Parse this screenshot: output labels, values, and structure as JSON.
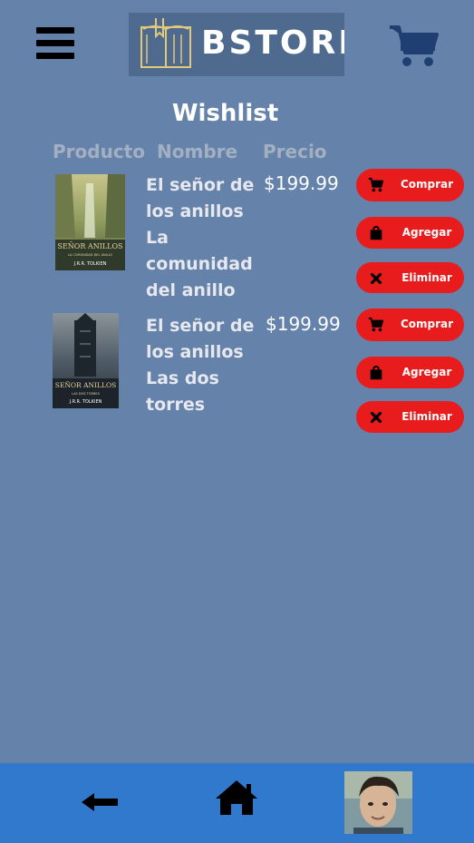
{
  "header": {
    "logo_text": "BSTORE",
    "menu_icon": "hamburger-menu-icon",
    "cart_icon": "shopping-cart-icon"
  },
  "page": {
    "title": "Wishlist",
    "columns": {
      "product": "Producto",
      "name": "Nombre",
      "price": "Precio"
    }
  },
  "items": [
    {
      "name_lines": [
        "El señor de",
        "los anillos",
        "La",
        "comunidad",
        "del anillo"
      ],
      "price": "$199.99",
      "cover": {
        "title": "SEÑOR ANILLOS",
        "subtitle": "LA COMUNIDAD DEL ANILLO",
        "author": "J.R.R. TOLKIEN"
      },
      "buttons": {
        "buy": "Comprar",
        "add": "Agregar",
        "remove": "Eliminar"
      }
    },
    {
      "name_lines": [
        "El señor de",
        "los anillos",
        "Las dos",
        "torres"
      ],
      "price": "$199.99",
      "cover": {
        "title": "SEÑOR ANILLOS",
        "subtitle": "LAS DOS TORRES",
        "author": "J.R.R. TOLKIEN"
      },
      "buttons": {
        "buy": "Comprar",
        "add": "Agregar",
        "remove": "Eliminar"
      }
    }
  ],
  "footer": {
    "back_icon": "back-arrow-icon",
    "home_icon": "home-icon",
    "avatar": "user-avatar"
  },
  "colors": {
    "background": "#6482aa",
    "button": "#e81c1c",
    "footer": "#3079cc",
    "cart": "#1f3f73"
  }
}
